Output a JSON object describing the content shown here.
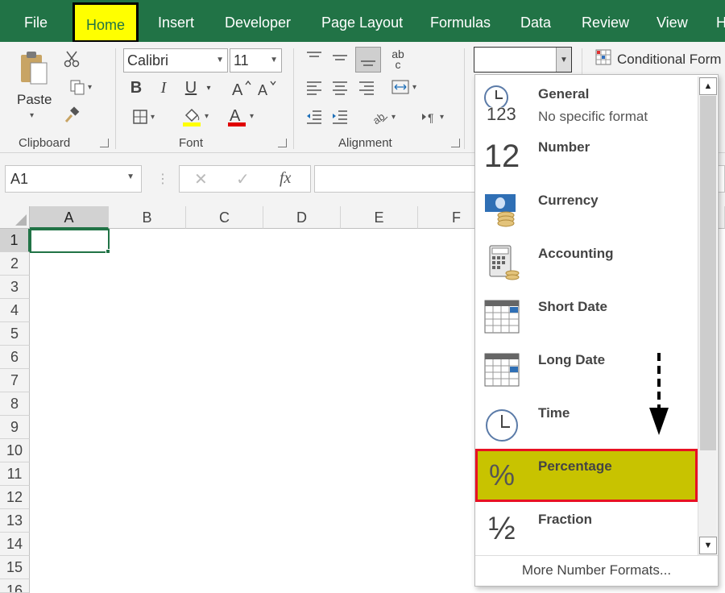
{
  "tabs": [
    {
      "label": "File"
    },
    {
      "label": "Home"
    },
    {
      "label": "Insert"
    },
    {
      "label": "Developer"
    },
    {
      "label": "Page Layout"
    },
    {
      "label": "Formulas"
    },
    {
      "label": "Data"
    },
    {
      "label": "Review"
    },
    {
      "label": "View"
    },
    {
      "label": "H"
    }
  ],
  "ribbon": {
    "clipboard": {
      "paste": "Paste",
      "group": "Clipboard"
    },
    "font": {
      "name": "Calibri",
      "size": "11",
      "group": "Font",
      "bold": "B",
      "italic": "I",
      "underline": "U"
    },
    "alignment": {
      "group": "Alignment",
      "ab": "ab",
      "c": "c"
    },
    "number": {
      "format_value": ""
    },
    "styles": {
      "conditional": "Conditional Form"
    }
  },
  "formula_bar": {
    "name_box": "A1",
    "fx": "fx",
    "cancel": "✕",
    "enter": "✓"
  },
  "grid": {
    "columns": [
      "A",
      "B",
      "C",
      "D",
      "E",
      "F"
    ],
    "rows": [
      "1",
      "2",
      "3",
      "4",
      "5",
      "6",
      "7",
      "8",
      "9",
      "10",
      "11",
      "12",
      "13",
      "14",
      "15",
      "16"
    ]
  },
  "dropdown": {
    "items": [
      {
        "name": "General",
        "desc": "No specific format",
        "icon": "clock-123"
      },
      {
        "name": "Number",
        "desc": "",
        "icon": "12"
      },
      {
        "name": "Currency",
        "desc": "",
        "icon": "banknote-coins"
      },
      {
        "name": "Accounting",
        "desc": "",
        "icon": "calculator-coins"
      },
      {
        "name": "Short Date",
        "desc": "",
        "icon": "calendar"
      },
      {
        "name": "Long Date",
        "desc": "",
        "icon": "calendar"
      },
      {
        "name": "Time",
        "desc": "",
        "icon": "clock"
      },
      {
        "name": "Percentage",
        "desc": "",
        "icon": "%"
      },
      {
        "name": "Fraction",
        "desc": "",
        "icon": "½"
      }
    ],
    "more": "More Number Formats...",
    "icon_text": {
      "general": "123",
      "number": "12",
      "percent": "%",
      "fraction": "½"
    },
    "scroll_up": "▲",
    "scroll_down": "▼"
  },
  "colors": {
    "tab_bar": "#217346",
    "highlight_fill": "#c8c300",
    "highlight_border": "#e81123",
    "home_tab": "#ffff00"
  }
}
